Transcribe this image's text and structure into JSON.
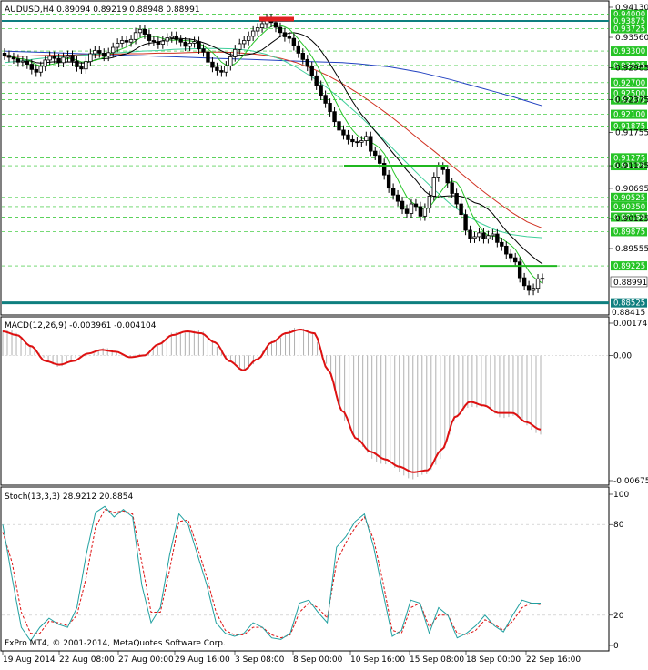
{
  "price_panel": {
    "header": "AUDUSD,H4  0.89094 0.89219 0.88948 0.88991",
    "price_ticks": [
      "0.94130",
      "0.93560",
      "0.92985",
      "0.92375",
      "0.91755",
      "0.91125",
      "0.90695",
      "0.90125",
      "0.89555"
    ],
    "levels": [
      {
        "label": "0.94000",
        "color": "#26c426"
      },
      {
        "label": "0.93875",
        "color": "#26c426"
      },
      {
        "label": "0.93725",
        "color": "#26c426"
      },
      {
        "label": "0.93300",
        "color": "#26c426"
      },
      {
        "label": "0.93025",
        "color": "#26c426"
      },
      {
        "label": "0.92700",
        "color": "#26c426"
      },
      {
        "label": "0.92500",
        "color": "#26c426"
      },
      {
        "label": "0.92375",
        "color": "#26c426"
      },
      {
        "label": "0.92100",
        "color": "#26c426"
      },
      {
        "label": "0.91875",
        "color": "#26c426"
      },
      {
        "label": "0.91275",
        "color": "#26c426"
      },
      {
        "label": "0.91125",
        "color": "#26c426"
      },
      {
        "label": "0.90525",
        "color": "#26c426"
      },
      {
        "label": "0.90350",
        "color": "#26c426"
      },
      {
        "label": "0.90150",
        "color": "#26c426"
      },
      {
        "label": "0.89875",
        "color": "#26c426"
      },
      {
        "label": "0.89225",
        "color": "#26c426"
      },
      {
        "label": "0.88525",
        "color": "#0f7f7f"
      }
    ],
    "current_price": "0.88991",
    "bottom_tick": "0.88415"
  },
  "macd_panel": {
    "header": "MACD(12,26,9) -0.003961 -0.004104",
    "ticks": [
      "0.001741",
      "0.00",
      "-0.006756"
    ]
  },
  "stoch_panel": {
    "header": "Stoch(13,3,3) 28.9212 20.8854",
    "ticks": [
      "100",
      "80",
      "20",
      "0"
    ]
  },
  "x_axis": {
    "labels": [
      "19 Aug 2014",
      "22 Aug 08:00",
      "27 Aug 00:00",
      "29 Aug 16:00",
      "3 Sep 08:00",
      "8 Sep 00:00",
      "10 Sep 16:00",
      "15 Sep 08:00",
      "18 Sep 00:00",
      "22 Sep 16:00"
    ]
  },
  "footer": "FxPro MT4, © 2001-2014, MetaQuotes Software Corp.",
  "colors": {
    "bull": "#000000",
    "bear": "#000000",
    "ma_fast": "#26c426",
    "ma_teal": "#3ecf9a",
    "ma_red": "#d03020",
    "ma_blue": "#2040c0",
    "ma_black": "#000000",
    "macd_line": "#dd1111",
    "macd_hist": "#b0b0b0",
    "stoch_main": "#20a0a0",
    "stoch_signal": "#dd1111",
    "level_green": "#26c426",
    "level_red": "#e02020"
  },
  "chart_data": [
    {
      "type": "candlestick",
      "title": "AUDUSD,H4",
      "ylim": [
        0.88415,
        0.9413
      ],
      "x_labels": [
        "19 Aug 2014",
        "22 Aug 08:00",
        "27 Aug 00:00",
        "29 Aug 16:00",
        "3 Sep 08:00",
        "8 Sep 00:00",
        "10 Sep 16:00",
        "15 Sep 08:00",
        "18 Sep 00:00",
        "22 Sep 16:00"
      ],
      "last_ohlc": {
        "open": 0.89094,
        "high": 0.89219,
        "low": 0.88948,
        "close": 0.88991
      },
      "closes": [
        0.9322,
        0.9318,
        0.9315,
        0.9309,
        0.9311,
        0.9305,
        0.9295,
        0.929,
        0.9301,
        0.9313,
        0.932,
        0.9316,
        0.9308,
        0.9318,
        0.9322,
        0.9311,
        0.93,
        0.9296,
        0.931,
        0.9325,
        0.9331,
        0.9326,
        0.932,
        0.9327,
        0.9337,
        0.9345,
        0.935,
        0.9347,
        0.9352,
        0.9365,
        0.9371,
        0.9362,
        0.935,
        0.9348,
        0.9343,
        0.9349,
        0.9355,
        0.9358,
        0.9352,
        0.9347,
        0.9339,
        0.9345,
        0.9348,
        0.9334,
        0.9328,
        0.9309,
        0.9299,
        0.9293,
        0.929,
        0.9302,
        0.9319,
        0.9333,
        0.9344,
        0.935,
        0.9358,
        0.9368,
        0.9374,
        0.9382,
        0.9392,
        0.9384,
        0.9375,
        0.9365,
        0.9357,
        0.9354,
        0.934,
        0.9326,
        0.9314,
        0.9301,
        0.9283,
        0.9265,
        0.9246,
        0.9231,
        0.9215,
        0.9196,
        0.918,
        0.9171,
        0.9162,
        0.9158,
        0.9157,
        0.916,
        0.9168,
        0.914,
        0.9132,
        0.9117,
        0.9095,
        0.907,
        0.9057,
        0.9045,
        0.903,
        0.9022,
        0.904,
        0.9035,
        0.9017,
        0.9032,
        0.9055,
        0.9091,
        0.911,
        0.9105,
        0.908,
        0.906,
        0.904,
        0.902,
        0.899,
        0.8975,
        0.8978,
        0.8985,
        0.8974,
        0.898,
        0.8983,
        0.8967,
        0.896,
        0.8945,
        0.8938,
        0.893,
        0.89,
        0.8885,
        0.8876,
        0.888,
        0.8898,
        0.8899
      ],
      "series": [
        {
          "name": "",
          "values": [
            0.933,
            0.9329,
            0.9328,
            0.9327,
            0.9326,
            0.9325,
            0.9324,
            0.9323,
            0.9322,
            0.9321,
            0.932,
            0.9319,
            0.9318,
            0.9317,
            0.9316,
            0.9315,
            0.9314,
            0.9313,
            0.9312,
            0.9311,
            0.931,
            0.9309,
            0.9308,
            0.9306,
            0.9303,
            0.93,
            0.9295,
            0.929,
            0.9283,
            0.9276,
            0.9268,
            0.926,
            0.9252,
            0.9244,
            0.9235,
            0.9226
          ]
        },
        {
          "name": "",
          "values": [
            0.932,
            0.932,
            0.9321,
            0.9322,
            0.9322,
            0.9323,
            0.9323,
            0.9324,
            0.9325,
            0.9325,
            0.9326,
            0.9326,
            0.9327,
            0.9328,
            0.9328,
            0.9327,
            0.9325,
            0.9322,
            0.9316,
            0.9308,
            0.9297,
            0.9284,
            0.9268,
            0.925,
            0.923,
            0.9209,
            0.9186,
            0.9162,
            0.9139,
            0.9115,
            0.9091,
            0.9067,
            0.9045,
            0.9024,
            0.9006,
            0.8994
          ]
        },
        {
          "name": "",
          "values": [
            0.9308,
            0.9311,
            0.9315,
            0.9318,
            0.932,
            0.9322,
            0.9324,
            0.9326,
            0.9328,
            0.933,
            0.9331,
            0.9333,
            0.9334,
            0.9335,
            0.9335,
            0.9334,
            0.9331,
            0.9324,
            0.9314,
            0.9299,
            0.9281,
            0.926,
            0.9236,
            0.921,
            0.9182,
            0.9153,
            0.9123,
            0.9094,
            0.9066,
            0.904,
            0.9019,
            0.9003,
            0.899,
            0.8982,
            0.8978,
            0.8976
          ]
        }
      ]
    },
    {
      "type": "line",
      "title": "MACD(12,26,9)",
      "ylim": [
        -0.006756,
        0.001741
      ],
      "series": [
        {
          "name": "",
          "values": [
            0.0013,
            0.0011,
            0.0005,
            -0.0003,
            -0.0005,
            -0.0003,
            0.0001,
            0.0003,
            0.0002,
            -0.0001,
            0.0,
            0.0006,
            0.0011,
            0.0013,
            0.0012,
            0.0007,
            -0.0003,
            -0.0008,
            -0.0002,
            0.0007,
            0.0012,
            0.0014,
            0.0012,
            -0.0008,
            -0.003,
            -0.0045,
            -0.0052,
            -0.0056,
            -0.006,
            -0.0063,
            -0.0062,
            -0.0051,
            -0.0033,
            -0.0025,
            -0.0027,
            -0.0031,
            -0.0031,
            -0.0036,
            -0.004
          ]
        }
      ]
    },
    {
      "type": "line",
      "title": "Stoch(13,3,3)",
      "ylim": [
        0,
        100
      ],
      "series": [
        {
          "name": "",
          "values": [
            80,
            45,
            12,
            3,
            12,
            18,
            14,
            12,
            25,
            60,
            88,
            92,
            85,
            90,
            85,
            40,
            15,
            25,
            60,
            87,
            80,
            60,
            40,
            15,
            8,
            6,
            8,
            15,
            12,
            5,
            4,
            8,
            28,
            30,
            22,
            15,
            65,
            72,
            82,
            87,
            65,
            35,
            6,
            10,
            30,
            28,
            8,
            25,
            20,
            5,
            8,
            13,
            20,
            13,
            9,
            20,
            30,
            28,
            28
          ]
        },
        {
          "name": "",
          "values": [
            75,
            55,
            22,
            8,
            8,
            16,
            15,
            13,
            20,
            45,
            78,
            90,
            88,
            89,
            87,
            55,
            22,
            22,
            50,
            82,
            83,
            65,
            45,
            22,
            10,
            7,
            7,
            12,
            12,
            7,
            5,
            7,
            22,
            28,
            25,
            18,
            55,
            68,
            78,
            85,
            70,
            42,
            10,
            8,
            25,
            28,
            12,
            20,
            20,
            8,
            7,
            10,
            17,
            14,
            10,
            16,
            25,
            28,
            27
          ]
        }
      ]
    }
  ]
}
